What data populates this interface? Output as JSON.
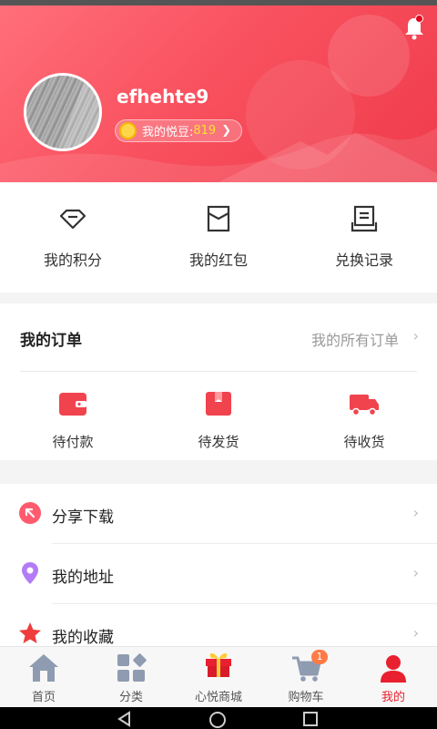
{
  "header": {
    "username": "efhehte9",
    "beans_label": "我的悦豆:",
    "beans_value": "819",
    "colors": {
      "gradient_start": "#ff6f7a",
      "gradient_end": "#ef3b4b",
      "beans_value": "#ffe033"
    }
  },
  "quick_links": [
    {
      "label": "我的积分",
      "icon": "diamond-icon"
    },
    {
      "label": "我的红包",
      "icon": "envelope-icon"
    },
    {
      "label": "兑换记录",
      "icon": "record-tray-icon"
    }
  ],
  "orders": {
    "title": "我的订单",
    "all_label": "我的所有订单",
    "items": [
      {
        "label": "待付款",
        "icon": "wallet-icon"
      },
      {
        "label": "待发货",
        "icon": "package-icon"
      },
      {
        "label": "待收货",
        "icon": "truck-icon"
      }
    ]
  },
  "menu": [
    {
      "label": "分享下载",
      "icon": "share-arrow-icon",
      "color": "#ff5a6e"
    },
    {
      "label": "我的地址",
      "icon": "location-pin-icon",
      "color": "#b27cf6"
    },
    {
      "label": "我的收藏",
      "icon": "star-icon",
      "color": "#f03c3c"
    }
  ],
  "tabbar": {
    "items": [
      {
        "label": "首页",
        "icon": "home-icon"
      },
      {
        "label": "分类",
        "icon": "category-icon"
      },
      {
        "label": "心悦商城",
        "icon": "gift-box-icon"
      },
      {
        "label": "购物车",
        "icon": "cart-icon",
        "badge": "1"
      },
      {
        "label": "我的",
        "icon": "user-icon",
        "active": true
      }
    ],
    "active_color": "#e8202f"
  }
}
